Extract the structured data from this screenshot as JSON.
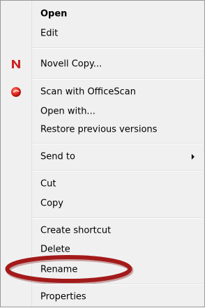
{
  "menu": {
    "items": [
      {
        "label": "Open",
        "bold": true,
        "icon": null,
        "submenu": false
      },
      {
        "label": "Edit",
        "bold": false,
        "icon": null,
        "submenu": false
      },
      {
        "label": "Novell Copy...",
        "bold": false,
        "icon": "novell-n-icon",
        "submenu": false
      },
      {
        "label": "Scan with OfficeScan",
        "bold": false,
        "icon": "officescan-icon",
        "submenu": false
      },
      {
        "label": "Open with...",
        "bold": false,
        "icon": null,
        "submenu": false
      },
      {
        "label": "Restore previous versions",
        "bold": false,
        "icon": null,
        "submenu": false
      },
      {
        "label": "Send to",
        "bold": false,
        "icon": null,
        "submenu": true
      },
      {
        "label": "Cut",
        "bold": false,
        "icon": null,
        "submenu": false
      },
      {
        "label": "Copy",
        "bold": false,
        "icon": null,
        "submenu": false
      },
      {
        "label": "Create shortcut",
        "bold": false,
        "icon": null,
        "submenu": false
      },
      {
        "label": "Delete",
        "bold": false,
        "icon": null,
        "submenu": false
      },
      {
        "label": "Rename",
        "bold": false,
        "icon": null,
        "submenu": false
      },
      {
        "label": "Properties",
        "bold": false,
        "icon": null,
        "submenu": false
      }
    ]
  },
  "colors": {
    "menu_background": "#f0f0f0",
    "novell_red": "#cc2222",
    "highlight_ellipse": "#a31a1a"
  }
}
